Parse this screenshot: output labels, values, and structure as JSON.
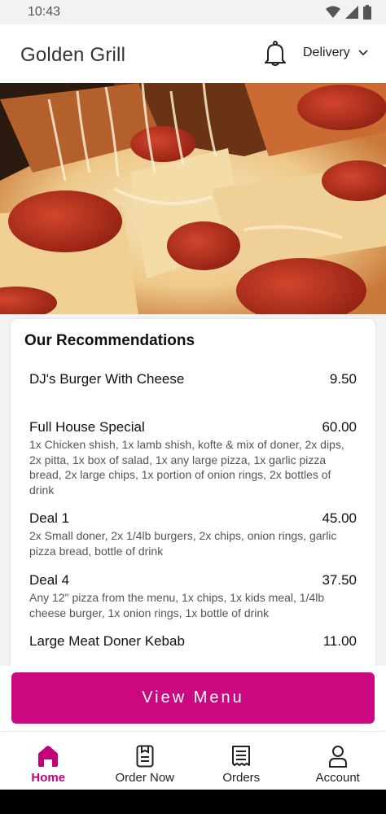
{
  "status_bar": {
    "time": "10:43",
    "icons": [
      "wifi-icon",
      "signal-icon",
      "battery-icon"
    ]
  },
  "header": {
    "title": "Golden Grill",
    "notification_icon": "bell-icon",
    "delivery_label": "Delivery",
    "dropdown_icon": "chevron-down-icon"
  },
  "recommendations": {
    "heading": "Our Recommendations",
    "items": [
      {
        "name": "DJ's Burger With Cheese",
        "price": "9.50",
        "description": ""
      },
      {
        "name": "Full House Special",
        "price": "60.00",
        "description": "1x Chicken shish, 1x lamb shish, kofte & mix of doner, 2x dips, 2x pitta, 1x box of salad, 1x any large pizza, 1x garlic pizza bread, 2x large chips, 1x portion of onion rings, 2x bottles of drink"
      },
      {
        "name": "Deal 1",
        "price": "45.00",
        "description": "2x Small doner, 2x 1/4lb burgers, 2x chips, onion rings, garlic pizza bread, bottle of drink"
      },
      {
        "name": "Deal 4",
        "price": "37.50",
        "description": "Any 12\" pizza from the menu, 1x chips, 1x kids meal, 1/4lb cheese burger, 1x onion rings, 1x bottle of drink"
      },
      {
        "name": "Large Meat Doner Kebab",
        "price": "11.00",
        "description": ""
      }
    ]
  },
  "view_menu_button": "View Menu",
  "bottom_nav": [
    {
      "label": "Home",
      "icon": "home-icon",
      "active": true
    },
    {
      "label": "Order Now",
      "icon": "order-icon",
      "active": false
    },
    {
      "label": "Orders",
      "icon": "receipt-icon",
      "active": false
    },
    {
      "label": "Account",
      "icon": "user-icon",
      "active": false
    }
  ],
  "colors": {
    "accent": "#cc0880",
    "active_nav": "#c2007a"
  }
}
